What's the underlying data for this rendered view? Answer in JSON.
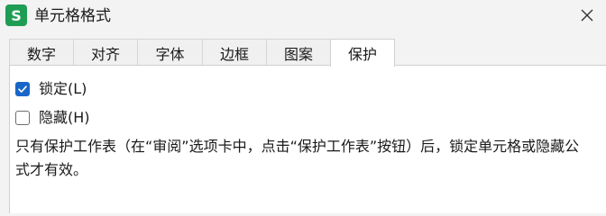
{
  "window": {
    "title": "单元格格式",
    "app_icon_letter": "S",
    "accent_color": "#1a66c8",
    "app_icon_color": "#1f9d55"
  },
  "tabs": [
    {
      "label": "数字",
      "active": false
    },
    {
      "label": "对齐",
      "active": false
    },
    {
      "label": "字体",
      "active": false
    },
    {
      "label": "边框",
      "active": false
    },
    {
      "label": "图案",
      "active": false
    },
    {
      "label": "保护",
      "active": true
    }
  ],
  "protection": {
    "locked": {
      "label": "锁定(L)",
      "checked": true
    },
    "hidden": {
      "label": "隐藏(H)",
      "checked": false
    },
    "note": "只有保护工作表（在“审阅”选项卡中，点击“保护工作表”按钮）后，锁定单元格或隐藏公式才有效。"
  }
}
